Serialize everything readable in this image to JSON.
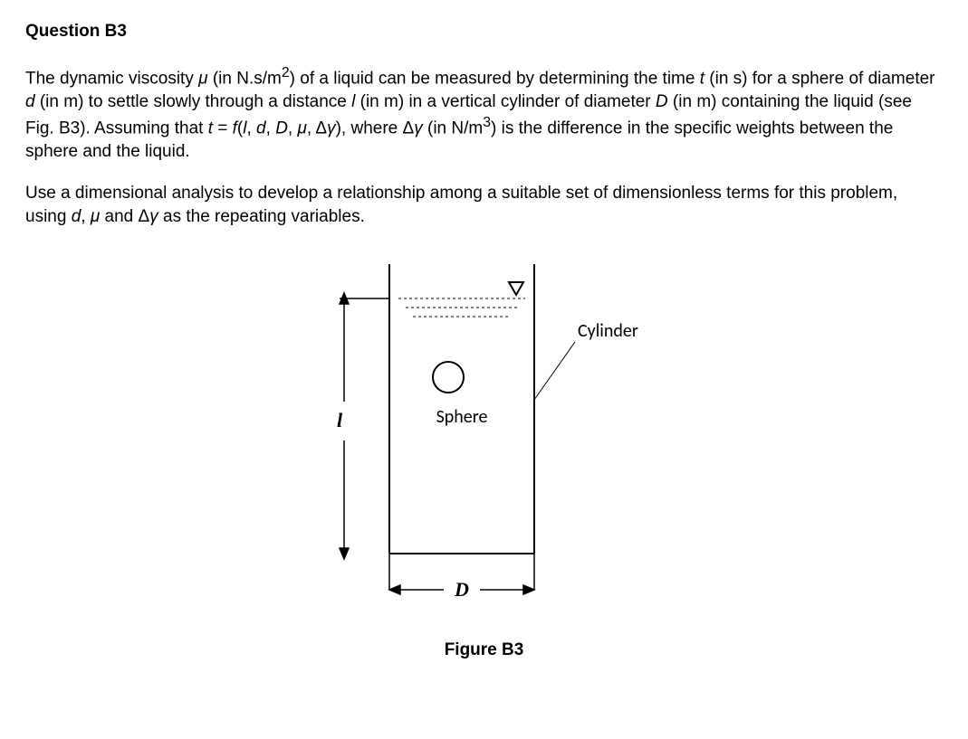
{
  "title": "Question B3",
  "para1_html": "The dynamic viscosity <span class='italic'>μ</span> (in N.s/m<sup>2</sup>) of a liquid can be measured by determining the time <span class='italic'>t</span> (in s) for a sphere of diameter <span class='italic'>d</span> (in m) to settle slowly through a distance <span class='italic'>l</span> (in m) in a vertical cylinder of diameter <span class='italic'>D</span> (in m) containing the liquid (see Fig. B3). Assuming that <span class='italic'>t</span> = <span class='italic'>f</span>(<span class='italic'>l</span>, <span class='italic'>d</span>, <span class='italic'>D</span>, <span class='italic'>μ</span>, Δ<span class='italic'>γ</span>), where Δ<span class='italic'>γ</span> (in N/m<sup>3</sup>) is the difference in the specific weights between the sphere and the liquid.",
  "para2_html": "Use a dimensional analysis to develop a relationship among a suitable set of dimensionless terms for this problem, using <span class='italic'>d</span>, <span class='italic'>μ</span> and Δ<span class='italic'>γ</span> as the repeating variables.",
  "figure": {
    "label_l": "l",
    "label_D": "D",
    "label_sphere": "Sphere",
    "label_cylinder": "Cylinder",
    "caption": "Figure B3"
  }
}
